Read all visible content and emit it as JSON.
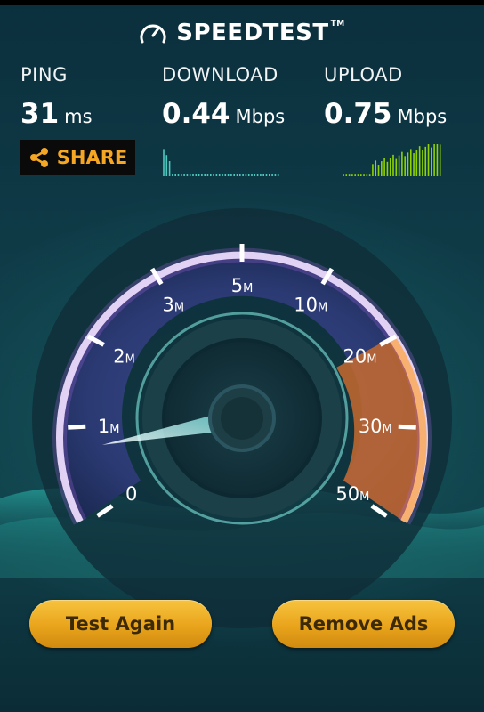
{
  "header": {
    "title": "SPEEDTEST",
    "trademark": "TM"
  },
  "stats": {
    "ping": {
      "label": "PING",
      "value": "31",
      "unit": "ms"
    },
    "download": {
      "label": "DOWNLOAD",
      "value": "0.44",
      "unit": "Mbps"
    },
    "upload": {
      "label": "UPLOAD",
      "value": "0.75",
      "unit": "Mbps"
    }
  },
  "share": {
    "label": "SHARE"
  },
  "gauge": {
    "scale": [
      {
        "num": "0",
        "suffix": ""
      },
      {
        "num": "1",
        "suffix": "M"
      },
      {
        "num": "2",
        "suffix": "M"
      },
      {
        "num": "3",
        "suffix": "M"
      },
      {
        "num": "5",
        "suffix": "M"
      },
      {
        "num": "10",
        "suffix": "M"
      },
      {
        "num": "20",
        "suffix": "M"
      },
      {
        "num": "30",
        "suffix": "M"
      },
      {
        "num": "50",
        "suffix": "M"
      }
    ],
    "needle_speed_mbps": 0.75
  },
  "buttons": {
    "test_again": "Test Again",
    "remove_ads": "Remove Ads"
  },
  "colors": {
    "accent": "#f5a623",
    "gauge_purple": "#b06cf0",
    "gauge_orange": "#f08a3a",
    "graph_green": "#8fd400",
    "graph_cyan": "#4fc9c0"
  }
}
